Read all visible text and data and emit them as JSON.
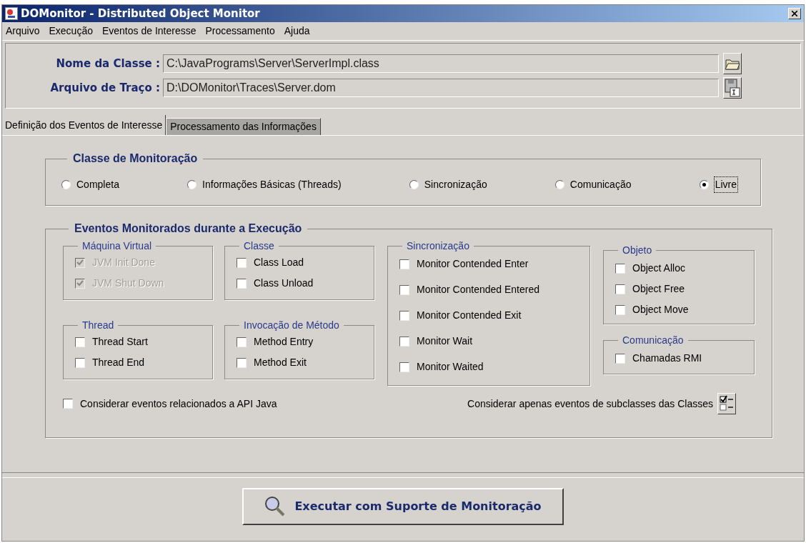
{
  "window": {
    "title": "DOMonitor - Distributed Object Monitor"
  },
  "menu": [
    "Arquivo",
    "Execução",
    "Eventos de Interesse",
    "Processamento",
    "Ajuda"
  ],
  "fields": [
    {
      "label": "Nome da Classe :",
      "value": "C:\\JavaPrograms\\Server\\ServerImpl.class",
      "kind": "open"
    },
    {
      "label": "Arquivo de Traço :",
      "value": "D:\\DOMonitor\\Traces\\Server.dom",
      "kind": "save"
    }
  ],
  "tabs": [
    {
      "label": "Definição dos Eventos de Interesse",
      "selected": true
    },
    {
      "label": "Processamento das Informações",
      "selected": false
    }
  ],
  "monitoring_class": {
    "title": "Classe de Monitoração",
    "options": [
      {
        "label": "Completa",
        "selected": false
      },
      {
        "label": "Informações Básicas (Threads)",
        "selected": false
      },
      {
        "label": "Sincronização",
        "selected": false
      },
      {
        "label": "Comunicação",
        "selected": false
      },
      {
        "label": "Livre",
        "selected": true
      }
    ]
  },
  "events": {
    "title": "Eventos Monitorados durante a Execução",
    "groups": [
      {
        "title": "Máquina Virtual",
        "items": [
          {
            "label": "JVM Init Done",
            "checked": true,
            "disabled": true
          },
          {
            "label": "JVM Shut Down",
            "checked": true,
            "disabled": true
          }
        ]
      },
      {
        "title": "Classe",
        "items": [
          {
            "label": "Class Load",
            "checked": false,
            "disabled": false
          },
          {
            "label": "Class Unload",
            "checked": false,
            "disabled": false
          }
        ]
      },
      {
        "title": "Thread",
        "items": [
          {
            "label": "Thread Start",
            "checked": false,
            "disabled": false
          },
          {
            "label": "Thread End",
            "checked": false,
            "disabled": false
          }
        ]
      },
      {
        "title": "Invocação de Método",
        "items": [
          {
            "label": "Method Entry",
            "checked": false,
            "disabled": false
          },
          {
            "label": "Method Exit",
            "checked": false,
            "disabled": false
          }
        ]
      },
      {
        "title": "Sincronização",
        "items": [
          {
            "label": "Monitor Contended Enter",
            "checked": false,
            "disabled": false
          },
          {
            "label": "Monitor Contended Entered",
            "checked": false,
            "disabled": false
          },
          {
            "label": "Monitor Contended Exit",
            "checked": false,
            "disabled": false
          },
          {
            "label": "Monitor Wait",
            "checked": false,
            "disabled": false
          },
          {
            "label": "Monitor Waited",
            "checked": false,
            "disabled": false
          }
        ]
      },
      {
        "title": "Objeto",
        "items": [
          {
            "label": "Object Alloc",
            "checked": false,
            "disabled": false
          },
          {
            "label": "Object Free",
            "checked": false,
            "disabled": false
          },
          {
            "label": "Object Move",
            "checked": false,
            "disabled": false
          }
        ]
      },
      {
        "title": "Comunicação",
        "items": [
          {
            "label": "Chamadas RMI",
            "checked": false,
            "disabled": false
          }
        ]
      }
    ],
    "api_option": {
      "label": "Considerar eventos relacionados a API Java",
      "checked": false
    },
    "subclasses_option": {
      "label": "Considerar apenas eventos de subclasses das Classes"
    }
  },
  "execute_button": {
    "label": "Executar com Suporte de Monitoração"
  }
}
